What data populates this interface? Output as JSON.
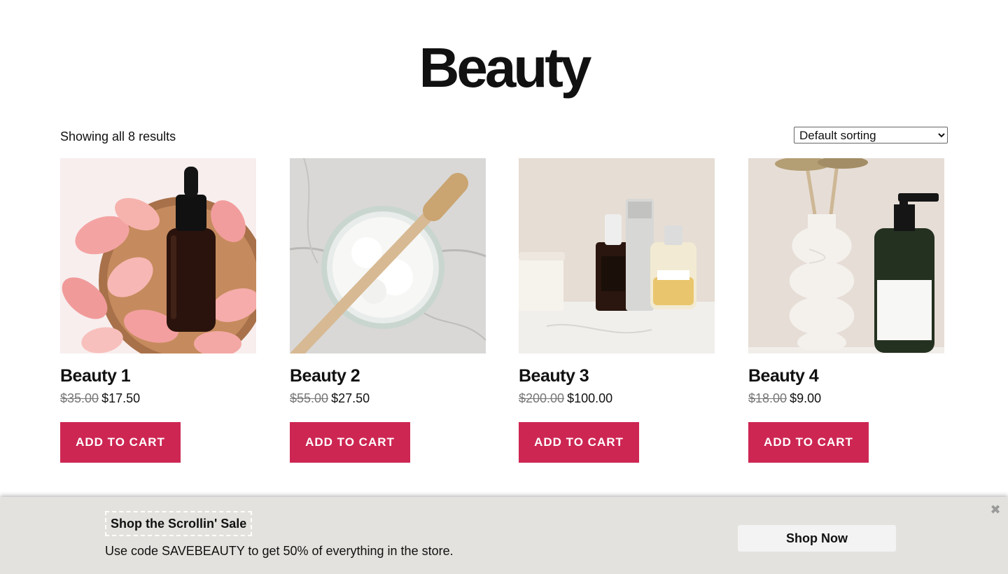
{
  "page": {
    "title": "Beauty"
  },
  "toolbar": {
    "results_text": "Showing all 8 results",
    "sort_selected": "Default sorting",
    "sort_options": [
      "Default sorting"
    ]
  },
  "products": [
    {
      "name": "Beauty 1",
      "old_price": "$35.00",
      "new_price": "$17.50",
      "button_label": "ADD TO CART",
      "image": "dropper-bottle-rose-petals"
    },
    {
      "name": "Beauty 2",
      "old_price": "$55.00",
      "new_price": "$27.50",
      "button_label": "ADD TO CART",
      "image": "bamboo-toothbrush-powder-jar"
    },
    {
      "name": "Beauty 3",
      "old_price": "$200.00",
      "new_price": "$100.00",
      "button_label": "ADD TO CART",
      "image": "serum-and-perfume-bottles"
    },
    {
      "name": "Beauty 4",
      "old_price": "$18.00",
      "new_price": "$9.00",
      "button_label": "ADD TO CART",
      "image": "white-vase-lotion-pump"
    }
  ],
  "banner": {
    "heading": "Shop the Scrollin' Sale",
    "text": "Use code SAVEBEAUTY to get 50% of everything in the store.",
    "button_label": "Shop Now",
    "close_icon": "close-icon"
  },
  "colors": {
    "accent": "#cd2653",
    "banner_bg": "#e3e2de",
    "strike_price": "#777777"
  }
}
